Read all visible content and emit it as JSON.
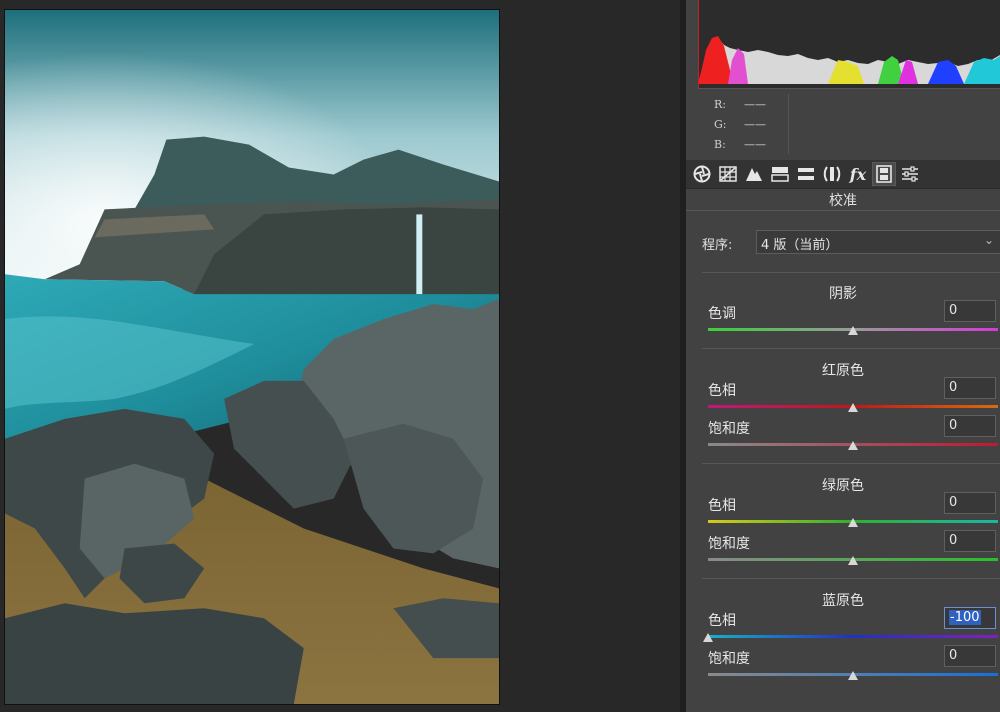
{
  "image": {
    "subject": "photo-seascape-cliffs-waterfall"
  },
  "info": {
    "rows": [
      {
        "label": "R:",
        "value": "——"
      },
      {
        "label": "G:",
        "value": "——"
      },
      {
        "label": "B:",
        "value": "——"
      }
    ]
  },
  "toolbar": {
    "tabs": [
      {
        "icon": "aperture-icon"
      },
      {
        "icon": "grid-icon"
      },
      {
        "icon": "mountain-icon"
      },
      {
        "icon": "split-toning-icon"
      },
      {
        "icon": "hsl-icon"
      },
      {
        "icon": "lens-icon"
      },
      {
        "icon": "fx-icon",
        "label": "fx"
      },
      {
        "icon": "film-icon"
      },
      {
        "icon": "sliders-icon"
      }
    ],
    "active_icon": "film-icon"
  },
  "panel": {
    "title": "校准",
    "process_label": "程序:",
    "process_value": "4 版（当前）",
    "groups": {
      "shadows": {
        "title": "阴影",
        "tint": {
          "label": "色调",
          "value": "0",
          "level": 0.5
        }
      },
      "red": {
        "title": "红原色",
        "hue": {
          "label": "色相",
          "value": "0",
          "level": 0.5
        },
        "saturation": {
          "label": "饱和度",
          "value": "0",
          "level": 0.5
        }
      },
      "green": {
        "title": "绿原色",
        "hue": {
          "label": "色相",
          "value": "0",
          "level": 0.5
        },
        "saturation": {
          "label": "饱和度",
          "value": "0",
          "level": 0.5
        }
      },
      "blue": {
        "title": "蓝原色",
        "hue": {
          "label": "色相",
          "value": "-100",
          "level": 0
        },
        "saturation": {
          "label": "饱和度",
          "value": "0",
          "level": 0.5
        }
      }
    }
  },
  "colors": {
    "panel_bg": "#424242",
    "canvas_bg": "#282828",
    "selection": "#2f62c0"
  }
}
